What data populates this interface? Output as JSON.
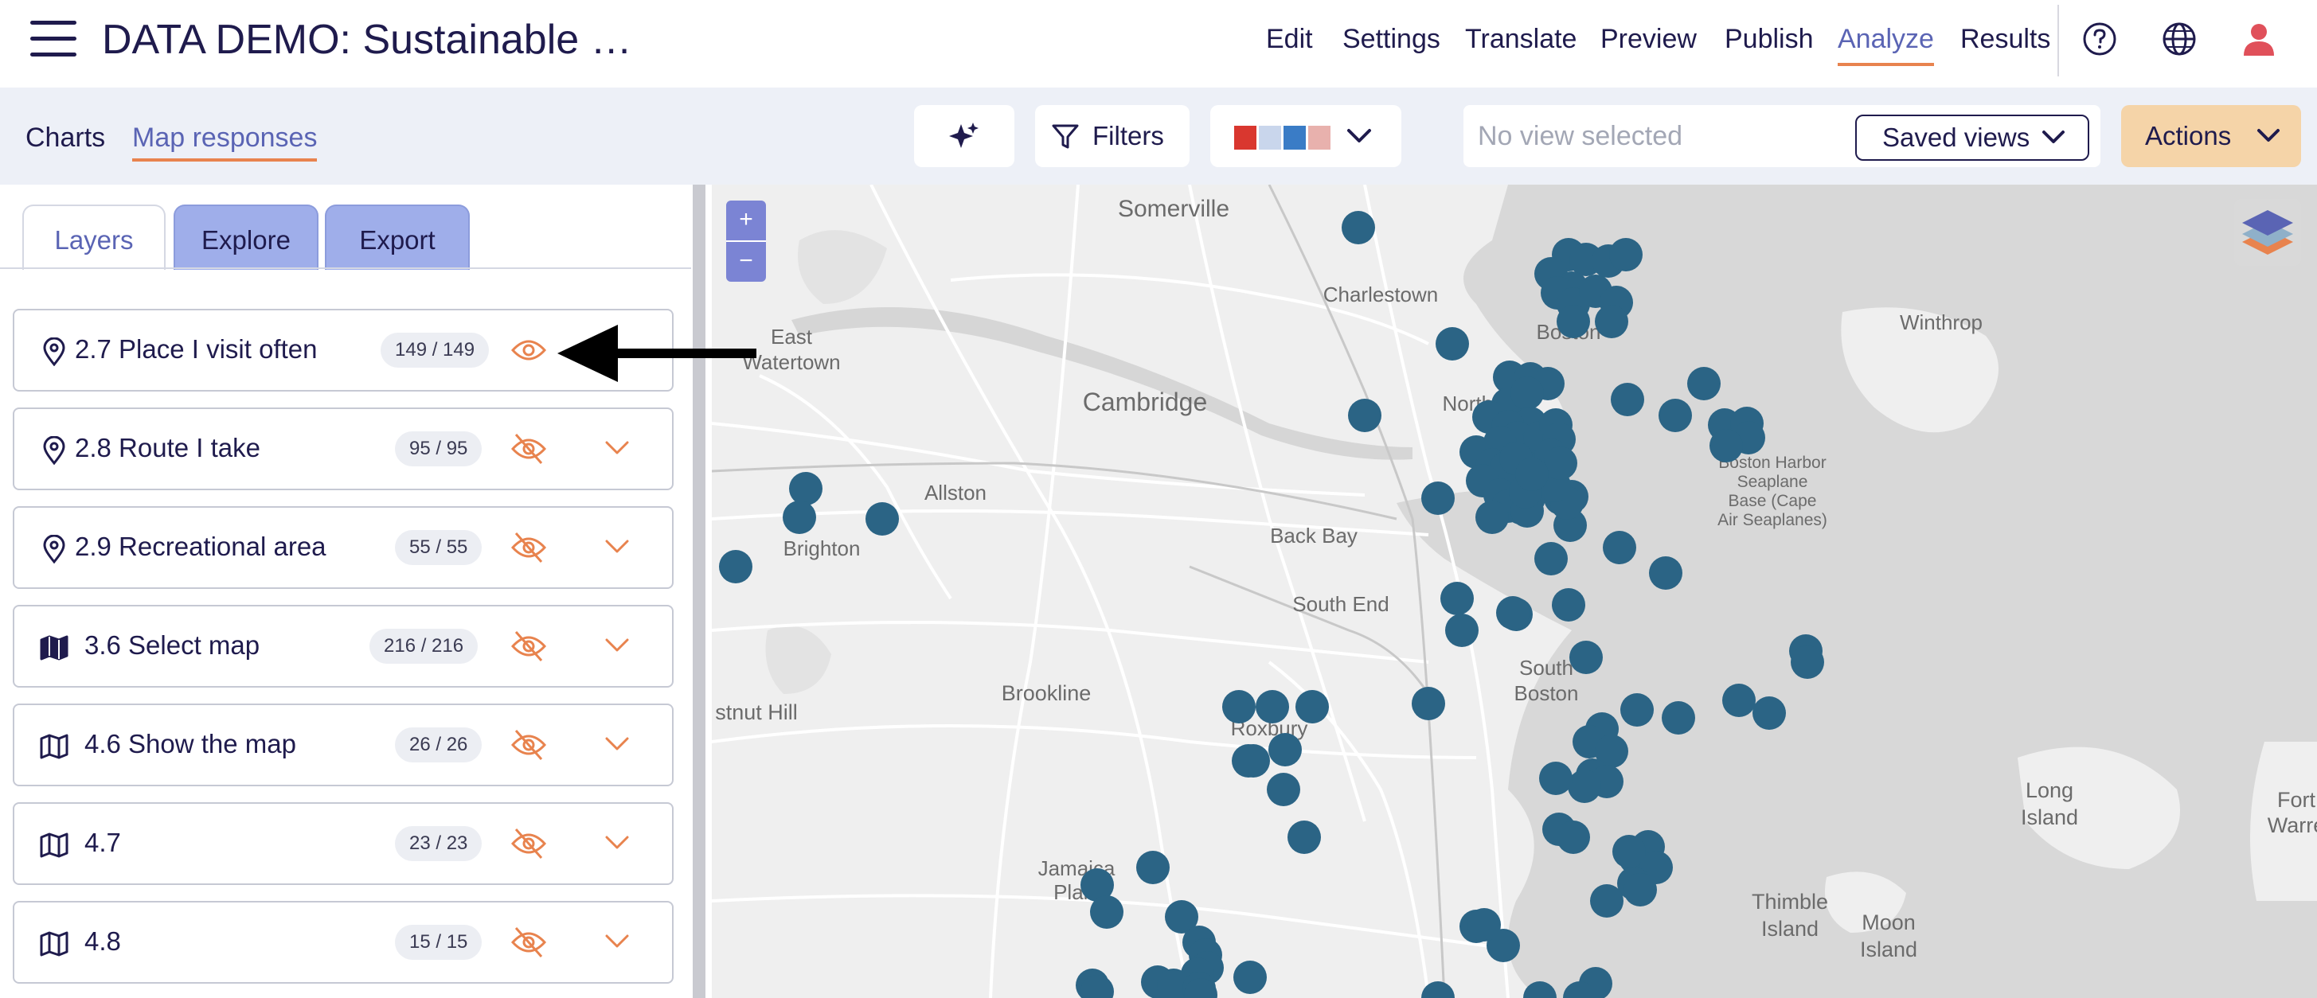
{
  "app_title": "DATA DEMO: Sustainable …",
  "nav": [
    "Edit",
    "Settings",
    "Translate",
    "Preview",
    "Publish",
    "Analyze",
    "Results"
  ],
  "nav_active": "Analyze",
  "icons": [
    "menu-icon",
    "help-icon",
    "globe-icon",
    "user-icon",
    "sparkle-icon",
    "filter-icon",
    "chevron-down-icon",
    "pin-icon",
    "map-icon",
    "eye-icon",
    "eye-off-icon",
    "layers-icon"
  ],
  "subtabs": [
    "Charts",
    "Map responses"
  ],
  "subtab_active": "Map responses",
  "toolbar": {
    "filters_label": "Filters",
    "palette_colors": [
      "#d9372f",
      "#c9d6ec",
      "#3a7cc6",
      "#e8b1ad"
    ],
    "view_placeholder": "No view selected",
    "saved_views_label": "Saved views",
    "actions_label": "Actions"
  },
  "panel_tabs": [
    "Layers",
    "Explore",
    "Export"
  ],
  "panel_tab_active": "Layers",
  "layers": [
    {
      "name": "2.7 Place I visit often",
      "count": "149 / 149",
      "icon": "pin-icon",
      "visible": true
    },
    {
      "name": "2.8 Route I take",
      "count": "95 / 95",
      "icon": "pin-icon",
      "visible": false
    },
    {
      "name": "2.9 Recreational area",
      "count": "55 / 55",
      "icon": "pin-icon",
      "visible": false
    },
    {
      "name": "3.6 Select map",
      "count": "216 / 216",
      "icon": "map-filled-icon",
      "visible": false
    },
    {
      "name": "4.6 Show the map",
      "count": "26 / 26",
      "icon": "map-icon",
      "visible": false
    },
    {
      "name": "4.7",
      "count": "23 / 23",
      "icon": "map-icon",
      "visible": false
    },
    {
      "name": "4.8",
      "count": "15 / 15",
      "icon": "map-icon",
      "visible": false
    }
  ],
  "map": {
    "zoom_in": "+",
    "zoom_out": "−",
    "marker_color": "#2b6485",
    "place_labels": [
      "Somerville",
      "Charlestown",
      "Winthrop",
      "East",
      "Watertown",
      "Cambridge",
      "Allston",
      "Brighton",
      "Back Bay",
      "South End",
      "Boston",
      "North End",
      "Boston Harbor",
      "Seaplane",
      "Base (Cape",
      "Air Seaplanes)",
      "South",
      "Boston",
      "Brookline",
      "stnut Hill",
      "Roxbury",
      "Jamaica",
      "Plain",
      "Thimble",
      "Island",
      "Long",
      "Island",
      "Moon",
      "Island",
      "Fort",
      "Warre"
    ]
  }
}
